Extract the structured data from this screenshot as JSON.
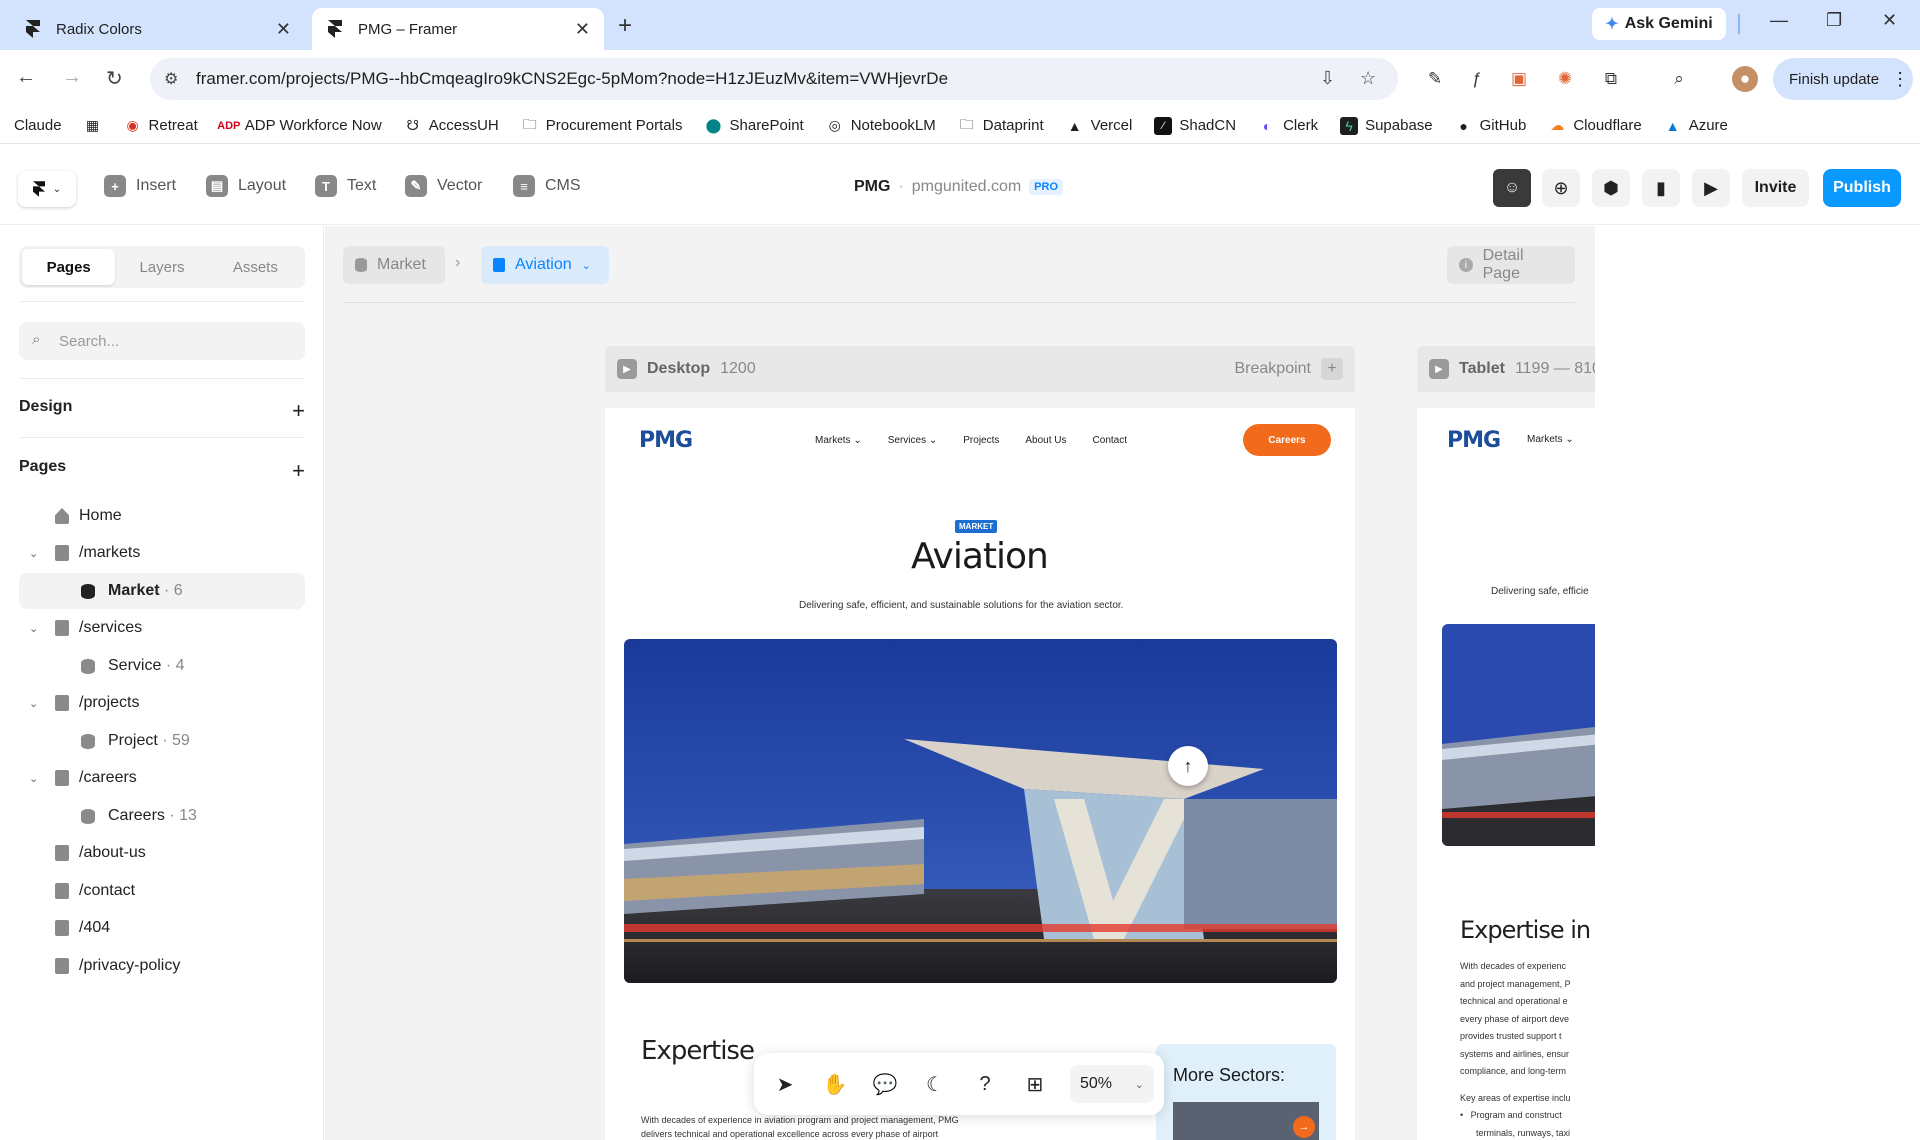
{
  "browser": {
    "tabs": [
      {
        "title": "Radix Colors",
        "active": false
      },
      {
        "title": "PMG – Framer",
        "active": true
      }
    ],
    "ask_gemini": "Ask Gemini",
    "url": "framer.com/projects/PMG--hbCmqeagIro9kCNS2Egc-5pMom?node=H1zJEuzMv&item=VWHjevrDe",
    "finish_update": "Finish update",
    "bookmarks": [
      "Claude",
      "Retreat",
      "ADP Workforce Now",
      "AccessUH",
      "Procurement Portals",
      "SharePoint",
      "NotebookLM",
      "Dataprint",
      "Vercel",
      "ShadCN",
      "Clerk",
      "Supabase",
      "GitHub",
      "Cloudflare",
      "Azure"
    ]
  },
  "framer": {
    "tools": [
      "Insert",
      "Layout",
      "Text",
      "Vector",
      "CMS"
    ],
    "project_name": "PMG",
    "project_domain": "pmgunited.com",
    "plan_badge": "PRO",
    "invite": "Invite",
    "publish": "Publish",
    "panel_tabs": [
      "Pages",
      "Layers",
      "Assets"
    ],
    "search_placeholder": "Search...",
    "design_label": "Design",
    "pages_label": "Pages",
    "pages": [
      {
        "label": "Home"
      },
      {
        "label": "/markets"
      },
      {
        "label": "Market",
        "count": "· 6"
      },
      {
        "label": "/services"
      },
      {
        "label": "Service",
        "count": "· 4"
      },
      {
        "label": "/projects"
      },
      {
        "label": "Project",
        "count": "· 59"
      },
      {
        "label": "/careers"
      },
      {
        "label": "Careers",
        "count": "· 13"
      },
      {
        "label": "/about-us"
      },
      {
        "label": "/contact"
      },
      {
        "label": "/404"
      },
      {
        "label": "/privacy-policy"
      }
    ],
    "breadcrumb": {
      "parent": "Market",
      "current": "Aviation"
    },
    "detail_page": "Detail Page",
    "breakpoints": {
      "desktop": {
        "name": "Desktop",
        "width": "1200",
        "action": "Breakpoint"
      },
      "tablet": {
        "name": "Tablet",
        "width": "1199 — 810"
      }
    },
    "zoom": "50%"
  },
  "site": {
    "logo": "PMG",
    "nav": [
      "Markets",
      "Services",
      "Projects",
      "About Us",
      "Contact"
    ],
    "careers_btn": "Careers",
    "badge": "MARKET",
    "title": "Aviation",
    "subtitle": "Delivering safe, efficient, and sustainable solutions for the aviation sector.",
    "expertise_title": "Expertise",
    "expertise_text_1": "With decades of experience in aviation program and project management, PMG",
    "expertise_text_2": "delivers technical and operational excellence across every phase of airport",
    "more_sectors": "More Sectors:",
    "tablet_subtitle": "Delivering safe, efficie",
    "tablet_expertise": "Expertise in",
    "tablet_paragraph": [
      "With decades of experienc",
      "and project management, P",
      "technical and operational e",
      "every phase of airport deve",
      "provides trusted support t",
      "systems and airlines, ensur",
      "compliance, and long-term"
    ],
    "tablet_key": "Key areas of expertise inclu",
    "tablet_bullets": [
      "Program and construct",
      "terminals, runways, taxi"
    ]
  }
}
